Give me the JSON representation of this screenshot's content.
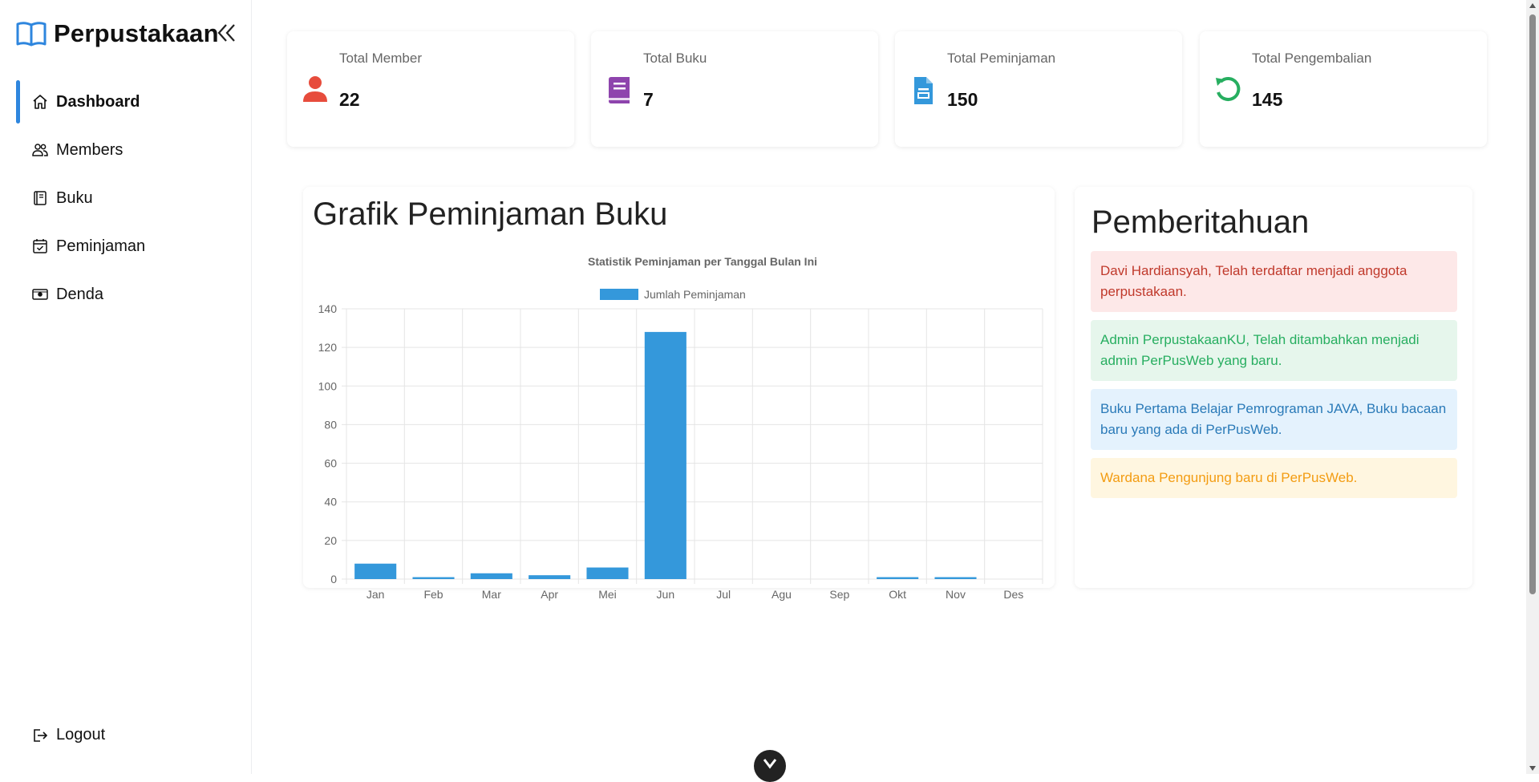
{
  "app": {
    "title": "Perpustakaan"
  },
  "sidebar": {
    "items": [
      {
        "label": "Dashboard",
        "icon": "home-icon",
        "active": true
      },
      {
        "label": "Members",
        "icon": "users-icon"
      },
      {
        "label": "Buku",
        "icon": "book-icon"
      },
      {
        "label": "Peminjaman",
        "icon": "calendar-check-icon"
      },
      {
        "label": "Denda",
        "icon": "cash-icon"
      }
    ],
    "logout_label": "Logout"
  },
  "stats": [
    {
      "label": "Total Member",
      "value": "22",
      "icon": "user-icon",
      "color": "#e74c3c"
    },
    {
      "label": "Total Buku",
      "value": "7",
      "icon": "book-icon",
      "color": "#8e44ad"
    },
    {
      "label": "Total Peminjaman",
      "value": "150",
      "icon": "file-icon",
      "color": "#3498db"
    },
    {
      "label": "Total Pengembalian",
      "value": "145",
      "icon": "undo-icon",
      "color": "#27ae60"
    }
  ],
  "chart_section": {
    "heading": "Grafik Peminjaman Buku"
  },
  "chart_data": {
    "type": "bar",
    "title": "Statistik Peminjaman per Tanggal Bulan Ini",
    "categories": [
      "Jan",
      "Feb",
      "Mar",
      "Apr",
      "Mei",
      "Jun",
      "Jul",
      "Agu",
      "Sep",
      "Okt",
      "Nov",
      "Des"
    ],
    "series": [
      {
        "name": "Jumlah Peminjaman",
        "values": [
          8,
          1,
          3,
          2,
          6,
          128,
          0,
          0,
          0,
          1,
          1,
          0
        ],
        "color": "#3498db"
      }
    ],
    "yticks": [
      0,
      20,
      40,
      60,
      80,
      100,
      120,
      140
    ],
    "ylim": [
      0,
      140
    ],
    "grid": true,
    "legend": "top"
  },
  "notifications": {
    "heading": "Pemberitahuan",
    "items": [
      {
        "text": "Davi Hardiansyah, Telah terdaftar menjadi anggota perpustakaan.",
        "bg": "#fde8e8",
        "color": "#c0392b"
      },
      {
        "text": "Admin PerpustakaanKU, Telah ditambahkan menjadi admin PerPusWeb yang baru.",
        "bg": "#e6f6ec",
        "color": "#27ae60"
      },
      {
        "text": "Buku Pertama Belajar Pemrograman JAVA, Buku bacaan baru yang ada di PerPusWeb.",
        "bg": "#e4f2fd",
        "color": "#2a7ab8"
      },
      {
        "text": "Wardana Pengunjung baru di PerPusWeb.",
        "bg": "#fff6e0",
        "color": "#f39c12"
      }
    ]
  }
}
